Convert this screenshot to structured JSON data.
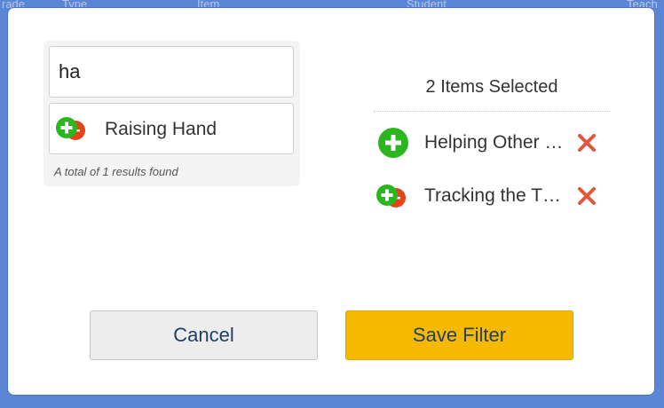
{
  "background": {
    "headers": [
      "rade",
      "Type",
      "Item",
      "Student",
      "Teach"
    ]
  },
  "search": {
    "value": "ha",
    "result_label": "Raising Hand",
    "result_icon": "plus-minus-icon",
    "result_count": "A total of 1 results found"
  },
  "selected": {
    "title": "2 Items Selected",
    "items": [
      {
        "label": "Helping Other …",
        "icon": "plus-icon"
      },
      {
        "label": "Tracking the T…",
        "icon": "plus-minus-icon"
      }
    ]
  },
  "buttons": {
    "cancel": "Cancel",
    "save": "Save Filter"
  },
  "colors": {
    "accent_green": "#2bb51f",
    "minus_red": "#e3451c",
    "remove_red": "#e2573c",
    "save_button": "#f6b900",
    "backdrop": "#5b86d6"
  }
}
